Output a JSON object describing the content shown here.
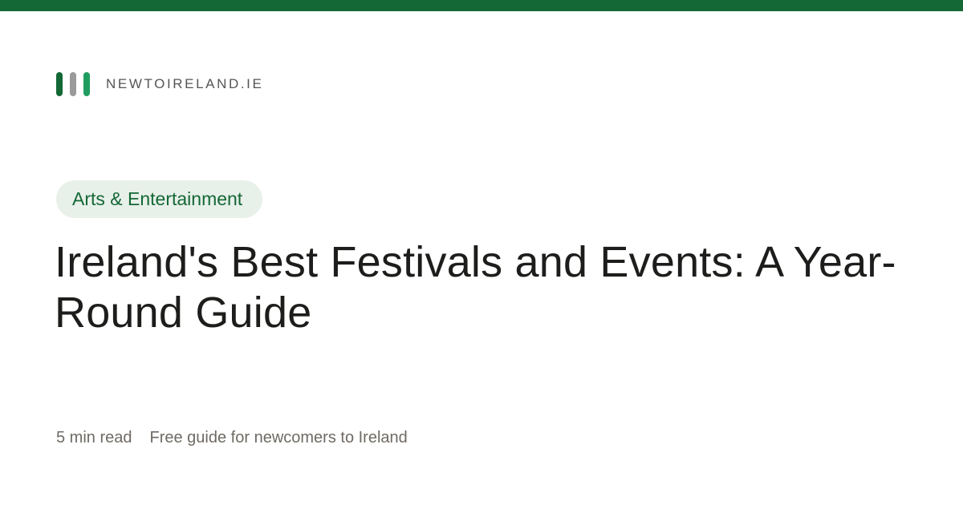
{
  "colors": {
    "top_bar": "#136835",
    "stripe_1": "#136835",
    "stripe_2": "#9a9a9a",
    "stripe_3": "#1f9d5f",
    "pill_bg": "#e8f0ea",
    "pill_text": "#136835"
  },
  "brand": {
    "name": "NEWTOIRELAND.IE"
  },
  "category": {
    "label": "Arts & Entertainment"
  },
  "article": {
    "title": "Ireland's Best Festivals and Events: A Year-Round Guide",
    "read_time": "5 min read",
    "tagline": "Free guide for newcomers to Ireland"
  }
}
